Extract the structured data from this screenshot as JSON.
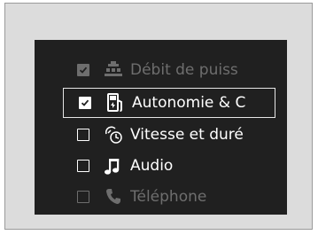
{
  "menu": {
    "items": [
      {
        "label": "Débit de puiss",
        "checked": true,
        "selected": false,
        "dim": true,
        "icon": "power-flow-icon"
      },
      {
        "label": "Autonomie & C",
        "checked": true,
        "selected": true,
        "dim": false,
        "icon": "fuel-range-icon"
      },
      {
        "label": "Vitesse et duré",
        "checked": false,
        "selected": false,
        "dim": false,
        "icon": "speed-time-icon"
      },
      {
        "label": "Audio",
        "checked": false,
        "selected": false,
        "dim": false,
        "icon": "music-note-icon"
      },
      {
        "label": "Téléphone",
        "checked": false,
        "selected": false,
        "dim": true,
        "icon": "phone-icon"
      }
    ]
  },
  "colors": {
    "screen_bg": "#202020",
    "text": "#ffffff",
    "dim_text": "#6e6e6e",
    "frame_bg": "#dcdcdc"
  }
}
